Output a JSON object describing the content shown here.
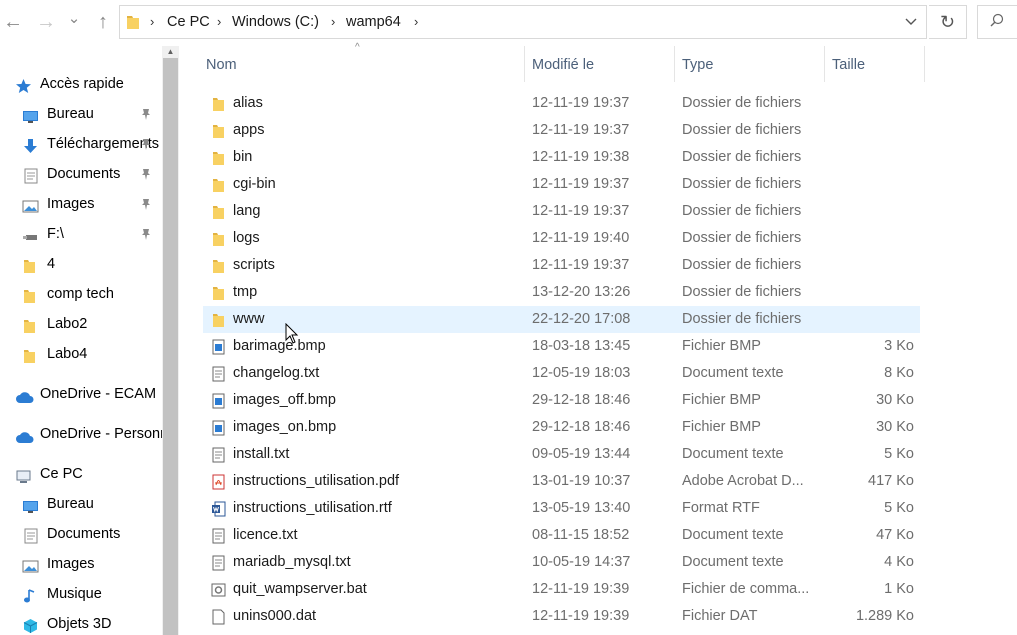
{
  "toolbar": {
    "back_icon": "back-arrow-icon",
    "forward_icon": "forward-arrow-icon",
    "dropdown_icon": "chevron-down-icon",
    "up_icon": "up-arrow-icon",
    "back_glyph": "←",
    "forward_glyph": "→",
    "down_glyph": "⌄",
    "up_glyph": "↑"
  },
  "address": {
    "crumbs": [
      "Ce PC",
      "Windows (C:)",
      "wamp64"
    ],
    "sep": "›",
    "drop": "⌄",
    "refresh": "↻"
  },
  "sidebar": {
    "items": [
      {
        "label": "Accès rapide",
        "icon": "star-icon",
        "pinned": false
      },
      {
        "label": "Bureau",
        "icon": "desktop-icon",
        "pinned": true
      },
      {
        "label": "Téléchargements",
        "icon": "download-icon",
        "pinned": true
      },
      {
        "label": "Documents",
        "icon": "documents-icon",
        "pinned": true
      },
      {
        "label": "Images",
        "icon": "images-icon",
        "pinned": true
      },
      {
        "label": "F:\\",
        "icon": "usb-drive-icon",
        "pinned": true
      },
      {
        "label": "4",
        "icon": "folder-icon",
        "pinned": false
      },
      {
        "label": "comp tech",
        "icon": "folder-icon",
        "pinned": false
      },
      {
        "label": "Labo2",
        "icon": "folder-icon",
        "pinned": false
      },
      {
        "label": "Labo4",
        "icon": "folder-icon",
        "pinned": false
      },
      {
        "label": "OneDrive - ECAM",
        "icon": "cloud-icon",
        "pinned": false
      },
      {
        "label": "OneDrive - Personnel",
        "icon": "cloud-icon",
        "pinned": false
      },
      {
        "label": "Ce PC",
        "icon": "computer-icon",
        "pinned": false
      },
      {
        "label": "Bureau",
        "icon": "desktop-icon",
        "pinned": false
      },
      {
        "label": "Documents",
        "icon": "documents-icon",
        "pinned": false
      },
      {
        "label": "Images",
        "icon": "images-icon",
        "pinned": false
      },
      {
        "label": "Musique",
        "icon": "music-icon",
        "pinned": false
      },
      {
        "label": "Objets 3D",
        "icon": "cube-icon",
        "pinned": false
      }
    ],
    "pin_glyph": "📌"
  },
  "columns": {
    "name": "Nom",
    "modified": "Modifié le",
    "type": "Type",
    "size": "Taille",
    "sort_glyph": "^"
  },
  "files": [
    {
      "name": "alias",
      "date": "12-11-19 19:37",
      "type": "Dossier de fichiers",
      "size": "",
      "icon": "folder-icon"
    },
    {
      "name": "apps",
      "date": "12-11-19 19:37",
      "type": "Dossier de fichiers",
      "size": "",
      "icon": "folder-icon"
    },
    {
      "name": "bin",
      "date": "12-11-19 19:38",
      "type": "Dossier de fichiers",
      "size": "",
      "icon": "folder-icon"
    },
    {
      "name": "cgi-bin",
      "date": "12-11-19 19:37",
      "type": "Dossier de fichiers",
      "size": "",
      "icon": "folder-icon"
    },
    {
      "name": "lang",
      "date": "12-11-19 19:37",
      "type": "Dossier de fichiers",
      "size": "",
      "icon": "folder-icon"
    },
    {
      "name": "logs",
      "date": "12-11-19 19:40",
      "type": "Dossier de fichiers",
      "size": "",
      "icon": "folder-icon"
    },
    {
      "name": "scripts",
      "date": "12-11-19 19:37",
      "type": "Dossier de fichiers",
      "size": "",
      "icon": "folder-icon"
    },
    {
      "name": "tmp",
      "date": "13-12-20 13:26",
      "type": "Dossier de fichiers",
      "size": "",
      "icon": "folder-icon"
    },
    {
      "name": "www",
      "date": "22-12-20 17:08",
      "type": "Dossier de fichiers",
      "size": "",
      "icon": "folder-icon",
      "hovered": true
    },
    {
      "name": "barimage.bmp",
      "date": "18-03-18 13:45",
      "type": "Fichier BMP",
      "size": "3 Ko",
      "icon": "bmp-file-icon"
    },
    {
      "name": "changelog.txt",
      "date": "12-05-19 18:03",
      "type": "Document texte",
      "size": "8 Ko",
      "icon": "text-file-icon"
    },
    {
      "name": "images_off.bmp",
      "date": "29-12-18 18:46",
      "type": "Fichier BMP",
      "size": "30 Ko",
      "icon": "bmp-file-icon"
    },
    {
      "name": "images_on.bmp",
      "date": "29-12-18 18:46",
      "type": "Fichier BMP",
      "size": "30 Ko",
      "icon": "bmp-file-icon"
    },
    {
      "name": "install.txt",
      "date": "09-05-19 13:44",
      "type": "Document texte",
      "size": "5 Ko",
      "icon": "text-file-icon"
    },
    {
      "name": "instructions_utilisation.pdf",
      "date": "13-01-19 10:37",
      "type": "Adobe Acrobat D...",
      "size": "417 Ko",
      "icon": "pdf-file-icon"
    },
    {
      "name": "instructions_utilisation.rtf",
      "date": "13-05-19 13:40",
      "type": "Format RTF",
      "size": "5 Ko",
      "icon": "word-file-icon"
    },
    {
      "name": "licence.txt",
      "date": "08-11-15 18:52",
      "type": "Document texte",
      "size": "47 Ko",
      "icon": "text-file-icon"
    },
    {
      "name": "mariadb_mysql.txt",
      "date": "10-05-19 14:37",
      "type": "Document texte",
      "size": "4 Ko",
      "icon": "text-file-icon"
    },
    {
      "name": "quit_wampserver.bat",
      "date": "12-11-19 19:39",
      "type": "Fichier de comma...",
      "size": "1 Ko",
      "icon": "batch-file-icon"
    },
    {
      "name": "unins000.dat",
      "date": "12-11-19 19:39",
      "type": "Fichier DAT",
      "size": "1.289 Ko",
      "icon": "generic-file-icon"
    }
  ],
  "colors": {
    "folder": "#f8d162",
    "hover_row": "#e5f3ff",
    "header_text": "#4c607a",
    "meta_text": "#6d6d6d",
    "accent_blue": "#2b7cd3"
  }
}
